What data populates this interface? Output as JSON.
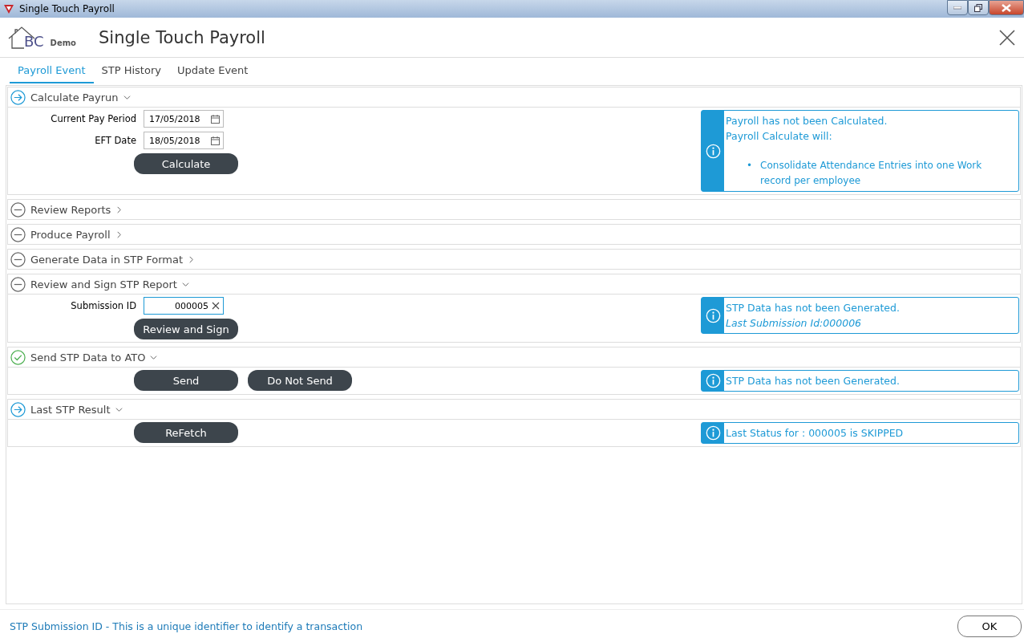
{
  "window": {
    "title": "Single Touch Payroll"
  },
  "header": {
    "logo_text": "BC",
    "logo_badge": "Demo",
    "title": "Single Touch Payroll"
  },
  "tabs": [
    {
      "label": "Payroll Event",
      "selected": true
    },
    {
      "label": "STP History",
      "selected": false
    },
    {
      "label": "Update Event",
      "selected": false
    }
  ],
  "sections": [
    {
      "title": "Calculate Payrun",
      "kind": "arrow",
      "expanded": true,
      "fields": [
        {
          "label": "Current Pay Period",
          "value": "17/05/2018",
          "kind": "date",
          "focused": false
        },
        {
          "label": "EFT Date",
          "value": "18/05/2018",
          "kind": "date",
          "focused": false
        }
      ],
      "buttons": [
        "Calculate"
      ],
      "info": [
        {
          "kind": "text",
          "text": "Payroll has not been Calculated."
        },
        {
          "kind": "text",
          "text": "Payroll Calculate will:"
        },
        {
          "kind": "spacer"
        },
        {
          "kind": "bullet",
          "marker": "•",
          "text": "Consolidate Attendance Entries into one Work record per employee"
        }
      ]
    },
    {
      "title": "Review Reports",
      "kind": "minus",
      "expanded": false
    },
    {
      "title": "Produce Payroll",
      "kind": "minus",
      "expanded": false
    },
    {
      "title": "Generate Data in STP Format",
      "kind": "minus",
      "expanded": false
    },
    {
      "title": "Review and Sign STP Report",
      "kind": "minus",
      "expanded": true,
      "fields": [
        {
          "label": "Submission ID",
          "value": "000005",
          "kind": "text",
          "focused": true
        }
      ],
      "buttons": [
        "Review and Sign"
      ],
      "info": [
        {
          "kind": "text",
          "text": "STP Data has not been Generated."
        },
        {
          "kind": "italic",
          "text": "Last Submission Id:000006"
        }
      ]
    },
    {
      "title": "Send STP Data to ATO",
      "kind": "check",
      "expanded": true,
      "buttons": [
        "Send",
        "Do Not Send"
      ],
      "info": [
        {
          "kind": "text",
          "text": "STP Data has not been Generated."
        }
      ]
    },
    {
      "title": "Last STP Result",
      "kind": "arrow",
      "expanded": true,
      "buttons": [
        "ReFetch"
      ],
      "info": [
        {
          "kind": "text",
          "text": "Last Status for : 000005 is SKIPPED"
        }
      ]
    }
  ],
  "footer": {
    "hint": "STP Submission ID - This is a unique identifier to identify a transaction",
    "button": "OK"
  }
}
